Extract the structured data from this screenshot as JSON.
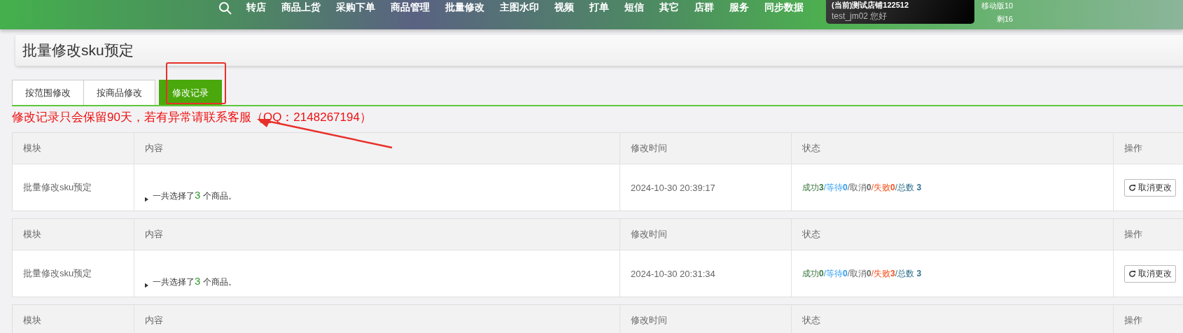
{
  "nav": {
    "items": [
      "转店",
      "商品上货",
      "采购下单",
      "商品管理",
      "批量修改",
      "主图水印",
      "视频",
      "打单",
      "短信",
      "其它",
      "店群",
      "服务",
      "同步数据"
    ],
    "user": {
      "shop": "(当前)测试店铺122512",
      "greeting": "test_jm02 您好"
    },
    "extra": [
      "移动版10",
      "剩16"
    ]
  },
  "page_title": "批量修改sku预定",
  "tabs": [
    {
      "label": "按范围修改",
      "selected": false
    },
    {
      "label": "按商品修改",
      "selected": false
    },
    {
      "label": "修改记录",
      "selected": true
    }
  ],
  "notice": "修改记录只会保留90天，若有异常请联系客服（QQ：2148267194）",
  "records": [
    {
      "kind": "record",
      "columns": [
        "模块",
        "内容",
        "修改时间",
        "状态",
        "操作"
      ],
      "module": "批量修改sku预定",
      "content_prefix": "一共选择了",
      "content_count": "3",
      "content_suffix": "个商品。",
      "time": "2024-10-30 20:39:17",
      "status": [
        {
          "label": "成功",
          "count": "3",
          "color": "#3c763d"
        },
        {
          "label": "/等待",
          "count": "0",
          "color": "#2d9cf0"
        },
        {
          "label": "/取消",
          "count": "0",
          "color": "#666666"
        },
        {
          "label": "/失败",
          "count": "0",
          "color": "#f4511e"
        },
        {
          "label": "/总数",
          "count": " 3",
          "color": "#31708f"
        }
      ],
      "action": "取消更改"
    },
    {
      "kind": "record",
      "columns": [
        "模块",
        "内容",
        "修改时间",
        "状态",
        "操作"
      ],
      "module": "批量修改sku预定",
      "content_prefix": "一共选择了",
      "content_count": "3",
      "content_suffix": "个商品。",
      "time": "2024-10-30 20:31:34",
      "status": [
        {
          "label": "成功",
          "count": "0",
          "color": "#3c763d"
        },
        {
          "label": "/等待",
          "count": "0",
          "color": "#2d9cf0"
        },
        {
          "label": "/取消",
          "count": "0",
          "color": "#666666"
        },
        {
          "label": "/失败",
          "count": "3",
          "color": "#f4511e"
        },
        {
          "label": "/总数",
          "count": " 3",
          "color": "#31708f"
        }
      ],
      "action": "取消更改"
    },
    {
      "kind": "header_only",
      "columns": [
        "模块",
        "内容",
        "修改时间",
        "状态",
        "操作"
      ]
    }
  ]
}
